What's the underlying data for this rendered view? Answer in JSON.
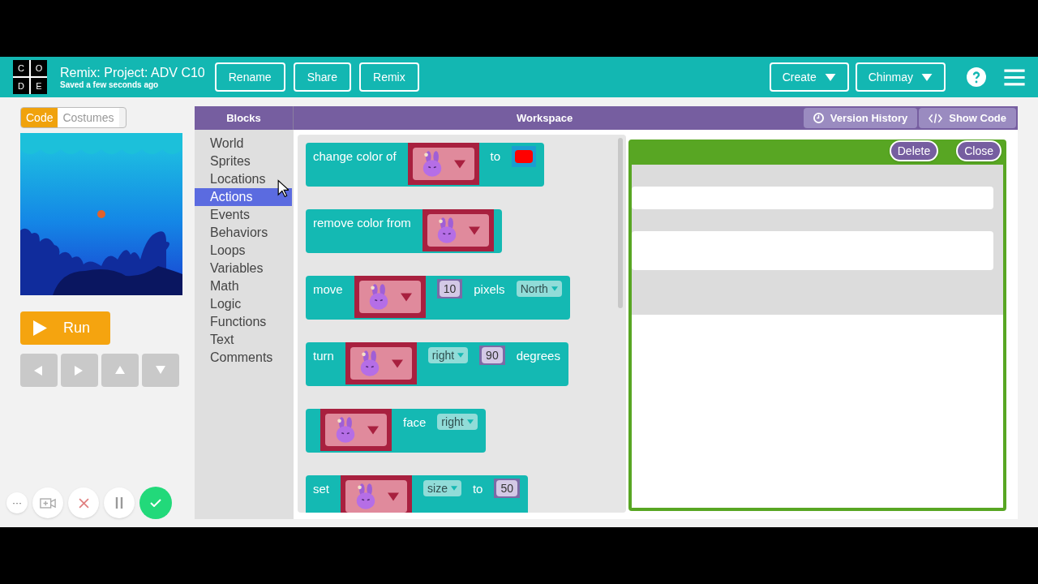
{
  "header": {
    "logo": [
      "C",
      "O",
      "D",
      "E"
    ],
    "title": "Remix: Project: ADV C10",
    "subtitle": "Saved a few seconds ago",
    "buttons": [
      "Rename",
      "Share",
      "Remix"
    ],
    "menus": [
      "Create",
      "Chinmay"
    ]
  },
  "mode_tabs": [
    {
      "label": "Code",
      "selected": true
    },
    {
      "label": "Costumes",
      "selected": false
    }
  ],
  "run_button": "Run",
  "arrow_keys": [
    {
      "kind": "left"
    },
    {
      "kind": "right"
    },
    {
      "kind": "up"
    },
    {
      "kind": "down"
    }
  ],
  "blocks_panel": {
    "title": "Blocks",
    "categories": [
      {
        "label": "World",
        "selected": false
      },
      {
        "label": "Sprites",
        "selected": false
      },
      {
        "label": "Locations",
        "selected": false
      },
      {
        "label": "Actions",
        "selected": true
      },
      {
        "label": "Events",
        "selected": false
      },
      {
        "label": "Behaviors",
        "selected": false
      },
      {
        "label": "Loops",
        "selected": false
      },
      {
        "label": "Variables",
        "selected": false
      },
      {
        "label": "Math",
        "selected": false
      },
      {
        "label": "Logic",
        "selected": false
      },
      {
        "label": "Functions",
        "selected": false
      },
      {
        "label": "Text",
        "selected": false
      },
      {
        "label": "Comments",
        "selected": false
      }
    ]
  },
  "workspace": {
    "title": "Workspace",
    "buttons": [
      {
        "kind": "history",
        "label": "Version History"
      },
      {
        "kind": "code",
        "label": "Show Code"
      }
    ]
  },
  "flyout_blocks": [
    {
      "parts": [
        {
          "kind": "text",
          "text": "change color of"
        },
        {
          "kind": "sprite"
        },
        {
          "kind": "text",
          "text": "to"
        },
        {
          "kind": "color",
          "color": "#ff0000"
        }
      ]
    },
    {
      "parts": [
        {
          "kind": "text",
          "text": "remove color from"
        },
        {
          "kind": "sprite"
        }
      ]
    },
    {
      "parts": [
        {
          "kind": "text",
          "text": "move"
        },
        {
          "kind": "sprite"
        },
        {
          "kind": "number",
          "text": "10"
        },
        {
          "kind": "text",
          "text": "pixels"
        },
        {
          "kind": "dropdown",
          "text": "North"
        }
      ]
    },
    {
      "parts": [
        {
          "kind": "text",
          "text": "turn"
        },
        {
          "kind": "sprite"
        },
        {
          "kind": "dropdown",
          "text": "right"
        },
        {
          "kind": "number",
          "text": "90"
        },
        {
          "kind": "text",
          "text": "degrees"
        }
      ]
    },
    {
      "parts": [
        {
          "kind": "sprite"
        },
        {
          "kind": "text",
          "text": "face"
        },
        {
          "kind": "dropdown",
          "text": "right"
        }
      ]
    },
    {
      "parts": [
        {
          "kind": "text",
          "text": "set"
        },
        {
          "kind": "sprite"
        },
        {
          "kind": "dropdown",
          "text": "size"
        },
        {
          "kind": "text",
          "text": "to"
        },
        {
          "kind": "number",
          "text": "50"
        }
      ]
    }
  ],
  "dialog": {
    "buttons": [
      "Delete",
      "Close"
    ]
  },
  "recorder": [
    {
      "kind": "more",
      "label": "···"
    },
    {
      "kind": "camera"
    },
    {
      "kind": "cancel"
    },
    {
      "kind": "pause"
    },
    {
      "kind": "done"
    }
  ]
}
